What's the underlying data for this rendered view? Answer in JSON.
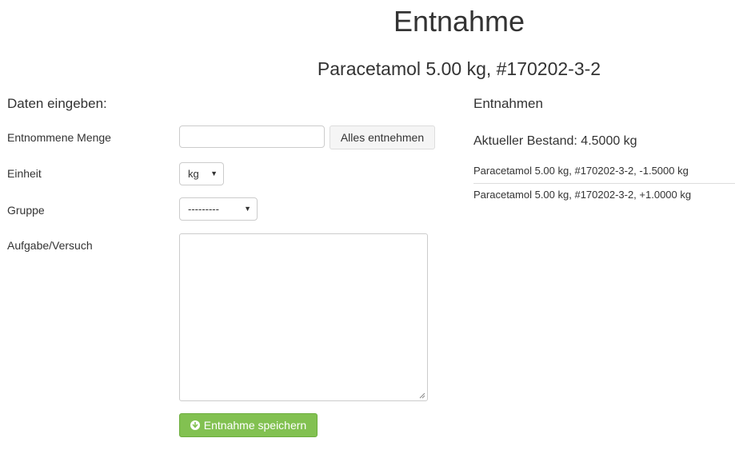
{
  "header": {
    "title": "Entnahme",
    "subtitle": "Paracetamol 5.00 kg, #170202-3-2"
  },
  "form": {
    "heading": "Daten eingeben:",
    "amount": {
      "label": "Entnommene Menge",
      "value": "",
      "take_all_label": "Alles entnehmen"
    },
    "unit": {
      "label": "Einheit",
      "selected": "kg"
    },
    "group": {
      "label": "Gruppe",
      "selected": "---------"
    },
    "task": {
      "label": "Aufgabe/Versuch",
      "value": ""
    },
    "submit_label": "Entnahme speichern",
    "submit_icon": "arrow-circle-down-icon"
  },
  "withdrawals": {
    "heading": "Entnahmen",
    "current_stock": "Aktueller Bestand: 4.5000 kg",
    "items": [
      "Paracetamol 5.00 kg, #170202-3-2, -1.5000 kg",
      "Paracetamol 5.00 kg, #170202-3-2, +1.0000 kg"
    ]
  },
  "colors": {
    "success": "#82c151",
    "text": "#333333",
    "border": "#cccccc"
  }
}
